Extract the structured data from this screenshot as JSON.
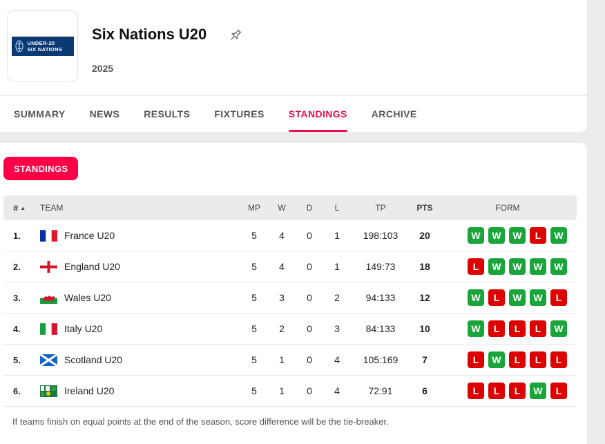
{
  "competition": {
    "title": "Six Nations U20",
    "season": "2025",
    "logo_line1": "UNDER-20",
    "logo_line2": "SIX NATIONS"
  },
  "tabs": [
    {
      "label": "SUMMARY",
      "active": false
    },
    {
      "label": "NEWS",
      "active": false
    },
    {
      "label": "RESULTS",
      "active": false
    },
    {
      "label": "FIXTURES",
      "active": false
    },
    {
      "label": "STANDINGS",
      "active": true
    },
    {
      "label": "ARCHIVE",
      "active": false
    }
  ],
  "section_pill": "STANDINGS",
  "table": {
    "headers": {
      "rank": "#",
      "team": "TEAM",
      "mp": "MP",
      "w": "W",
      "d": "D",
      "l": "L",
      "tp": "TP",
      "pts": "PTS",
      "form": "FORM"
    },
    "rows": [
      {
        "rank": "1.",
        "team": "France U20",
        "flag": "france-flag-icon",
        "mp": "5",
        "w": "4",
        "d": "0",
        "l": "1",
        "tp": "198:103",
        "pts": "20",
        "form": [
          "W",
          "W",
          "W",
          "L",
          "W"
        ]
      },
      {
        "rank": "2.",
        "team": "England U20",
        "flag": "england-flag-icon",
        "mp": "5",
        "w": "4",
        "d": "0",
        "l": "1",
        "tp": "149:73",
        "pts": "18",
        "form": [
          "L",
          "W",
          "W",
          "W",
          "W"
        ]
      },
      {
        "rank": "3.",
        "team": "Wales U20",
        "flag": "wales-flag-icon",
        "mp": "5",
        "w": "3",
        "d": "0",
        "l": "2",
        "tp": "94:133",
        "pts": "12",
        "form": [
          "W",
          "L",
          "W",
          "W",
          "L"
        ]
      },
      {
        "rank": "4.",
        "team": "Italy U20",
        "flag": "italy-flag-icon",
        "mp": "5",
        "w": "2",
        "d": "0",
        "l": "3",
        "tp": "84:133",
        "pts": "10",
        "form": [
          "W",
          "L",
          "L",
          "L",
          "W"
        ]
      },
      {
        "rank": "5.",
        "team": "Scotland U20",
        "flag": "scotland-flag-icon",
        "mp": "5",
        "w": "1",
        "d": "0",
        "l": "4",
        "tp": "105:169",
        "pts": "7",
        "form": [
          "L",
          "W",
          "L",
          "L",
          "L"
        ]
      },
      {
        "rank": "6.",
        "team": "Ireland U20",
        "flag": "ireland-rugby-flag-icon",
        "mp": "5",
        "w": "1",
        "d": "0",
        "l": "4",
        "tp": "72:91",
        "pts": "6",
        "form": [
          "L",
          "L",
          "L",
          "W",
          "L"
        ]
      }
    ]
  },
  "footnote": "If teams finish on equal points at the end of the season, score difference will be the tie-breaker.",
  "colors": {
    "accent": "#e8104e",
    "pill": "#ff0046",
    "win": "#1aa53a",
    "loss": "#dc0000"
  }
}
